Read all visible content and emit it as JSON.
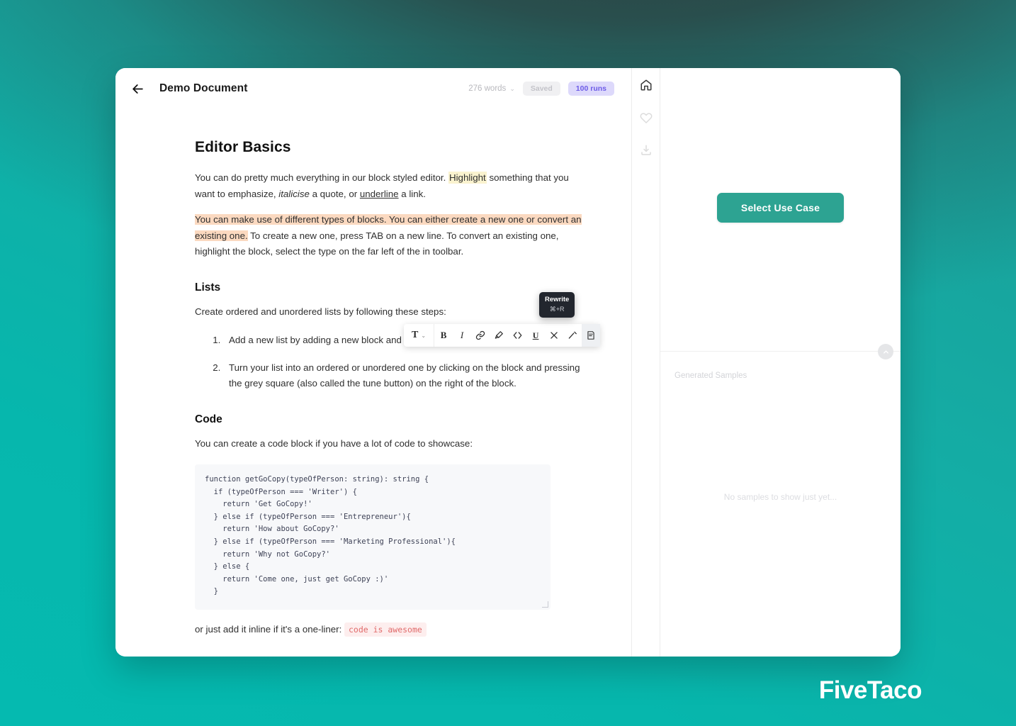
{
  "window": {
    "header": {
      "back_icon": "arrow-left-icon",
      "title": "Demo Document",
      "word_count": "276 words",
      "word_count_chevron": "⌄",
      "saved_badge": "Saved",
      "runs_badge": "100 runs"
    },
    "document": {
      "h1": "Editor Basics",
      "p1": {
        "seg1": "You can do pretty much everything in our block styled editor. ",
        "highlight": "Highlight",
        "seg2": " something that you want to emphasize, ",
        "italic": "italicise",
        "seg3": " a quote, or ",
        "underline": "underline",
        "seg4": " a link."
      },
      "p2": {
        "orange1": "You can make use of different types of blocks. You can either create a new one or convert an existing one.",
        "rest": " To create a new one, press TAB on a new line. To convert an existing one, highlight the block, select the type on the far left of the in toolbar."
      },
      "h2_lists": "Lists",
      "lists_intro": "Create ordered and unordered lists by following these steps:",
      "list_items": [
        "Add a new list by adding a new block and selecting the list option.",
        "Turn your list into an ordered or unordered one by clicking on the block and pressing the grey square (also called the tune button) on the right of the block."
      ],
      "h2_code": "Code",
      "code_intro": "You can create a code block if you have a lot of code to showcase:",
      "code_block": "function getGoCopy(typeOfPerson: string): string {\n  if (typeOfPerson === 'Writer') {\n    return 'Get GoCopy!'\n  } else if (typeOfPerson === 'Entrepreneur'){\n    return 'How about GoCopy?'\n  } else if (typeOfPerson === 'Marketing Professional'){\n    return 'Why not GoCopy?'\n  } else {\n    return 'Come one, just get GoCopy :)'\n  }",
      "inline_prefix": "or just add it inline if it's a one-liner: ",
      "inline_code": "code is awesome"
    },
    "format_toolbar": {
      "type_label": "T",
      "type_chevron": "⌄",
      "buttons": [
        {
          "name": "bold-icon",
          "label": "B"
        },
        {
          "name": "italic-icon",
          "label": "I"
        },
        {
          "name": "link-icon",
          "label": "link"
        },
        {
          "name": "marker-icon",
          "label": "marker"
        },
        {
          "name": "inline-code-icon",
          "label": "<>"
        },
        {
          "name": "underline-icon",
          "label": "U"
        },
        {
          "name": "strikethrough-icon",
          "label": "strike"
        },
        {
          "name": "superscript-icon",
          "label": "superscript"
        },
        {
          "name": "rewrite-icon",
          "label": "rewrite"
        }
      ]
    },
    "tooltip": {
      "label": "Rewrite",
      "shortcut": "⌘+R"
    },
    "right_rail": {
      "items": [
        {
          "name": "home-icon",
          "label": "Home",
          "active": true
        },
        {
          "name": "heart-icon",
          "label": "Favorites",
          "active": false
        },
        {
          "name": "download-icon",
          "label": "Download",
          "active": false
        }
      ]
    },
    "samples_panel": {
      "select_use_case_button": "Select Use Case",
      "collapse_chevron": "⌃",
      "generated_samples_label": "Generated Samples",
      "empty_state": "No samples to show just yet..."
    }
  },
  "watermark": "FiveTaco",
  "colors": {
    "accent_teal": "#2da392",
    "background_teal": "#06b7ad",
    "runs_badge_bg": "#ddd9fb",
    "runs_badge_text": "#6d5ce7",
    "highlight_yellow": "#faf3cf",
    "highlight_orange": "#fbd9c0",
    "inline_code_text": "#e06a6a",
    "tooltip_bg": "#22262e"
  }
}
